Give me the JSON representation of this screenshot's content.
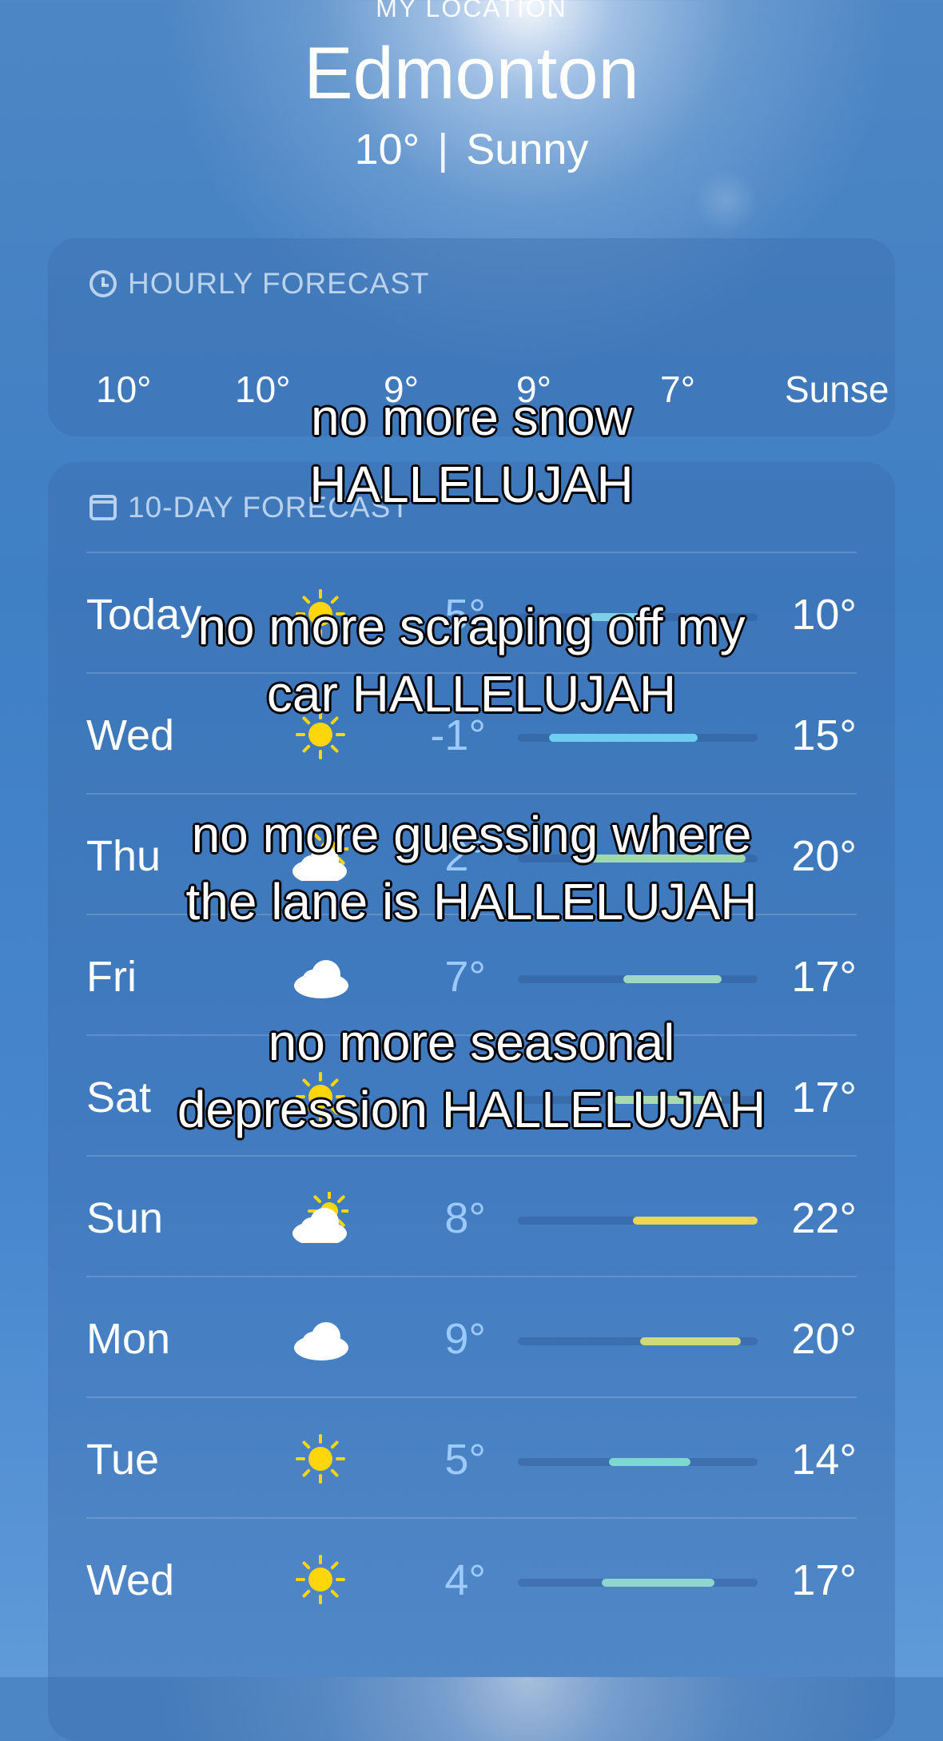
{
  "header": {
    "location_label": "MY LOCATION",
    "city": "Edmonton",
    "temperature": "10°",
    "separator": "|",
    "condition": "Sunny"
  },
  "hourly": {
    "title": "HOURLY FORECAST",
    "icon": "clock-icon",
    "temps": [
      "10°",
      "10°",
      "9°",
      "9°",
      "7°",
      "Sunse"
    ]
  },
  "daily": {
    "title": "10-DAY FORECAST",
    "icon": "calendar-icon",
    "rows": [
      {
        "day": "Today",
        "icon": "sun-icon",
        "low": "5°",
        "high": "10°",
        "range": [
          0.3,
          0.55
        ],
        "color": "#7ed0e8"
      },
      {
        "day": "Wed",
        "icon": "sun-icon",
        "low": "-1°",
        "high": "15°",
        "range": [
          0.13,
          0.75
        ],
        "color": "#6fcdf0"
      },
      {
        "day": "Thu",
        "icon": "partly-cloudy-icon",
        "low": "2°",
        "high": "20°",
        "range": [
          0.3,
          0.95
        ],
        "color": "#9fd9b0"
      },
      {
        "day": "Fri",
        "icon": "cloud-icon",
        "low": "7°",
        "high": "17°",
        "range": [
          0.44,
          0.85
        ],
        "color": "#9ed7c2"
      },
      {
        "day": "Sat",
        "icon": "sun-icon",
        "low": "",
        "high": "17°",
        "range": [
          0.4,
          0.85
        ],
        "color": "#a8d9b0"
      },
      {
        "day": "Sun",
        "icon": "partly-cloudy-icon",
        "low": "8°",
        "high": "22°",
        "range": [
          0.48,
          1.0
        ],
        "color": "#e9d55a"
      },
      {
        "day": "Mon",
        "icon": "cloud-icon",
        "low": "9°",
        "high": "20°",
        "range": [
          0.51,
          0.93
        ],
        "color": "#cfd97a"
      },
      {
        "day": "Tue",
        "icon": "sun-icon",
        "low": "5°",
        "high": "14°",
        "range": [
          0.38,
          0.72
        ],
        "color": "#7fd8d0"
      },
      {
        "day": "Wed",
        "icon": "sun-icon",
        "low": "4°",
        "high": "17°",
        "range": [
          0.35,
          0.82
        ],
        "color": "#8fd6d0"
      }
    ]
  },
  "overlay_captions": [
    "no more snow\nHALLELUJAH",
    "no more scraping off my\ncar HALLELUJAH",
    "no more guessing where\nthe lane is HALLELUJAH",
    "no more seasonal\ndepression HALLELUJAH"
  ],
  "colors": {
    "sun": "#ffd60a",
    "cloud": "#ffffff",
    "low_text": "#a0cdff"
  }
}
